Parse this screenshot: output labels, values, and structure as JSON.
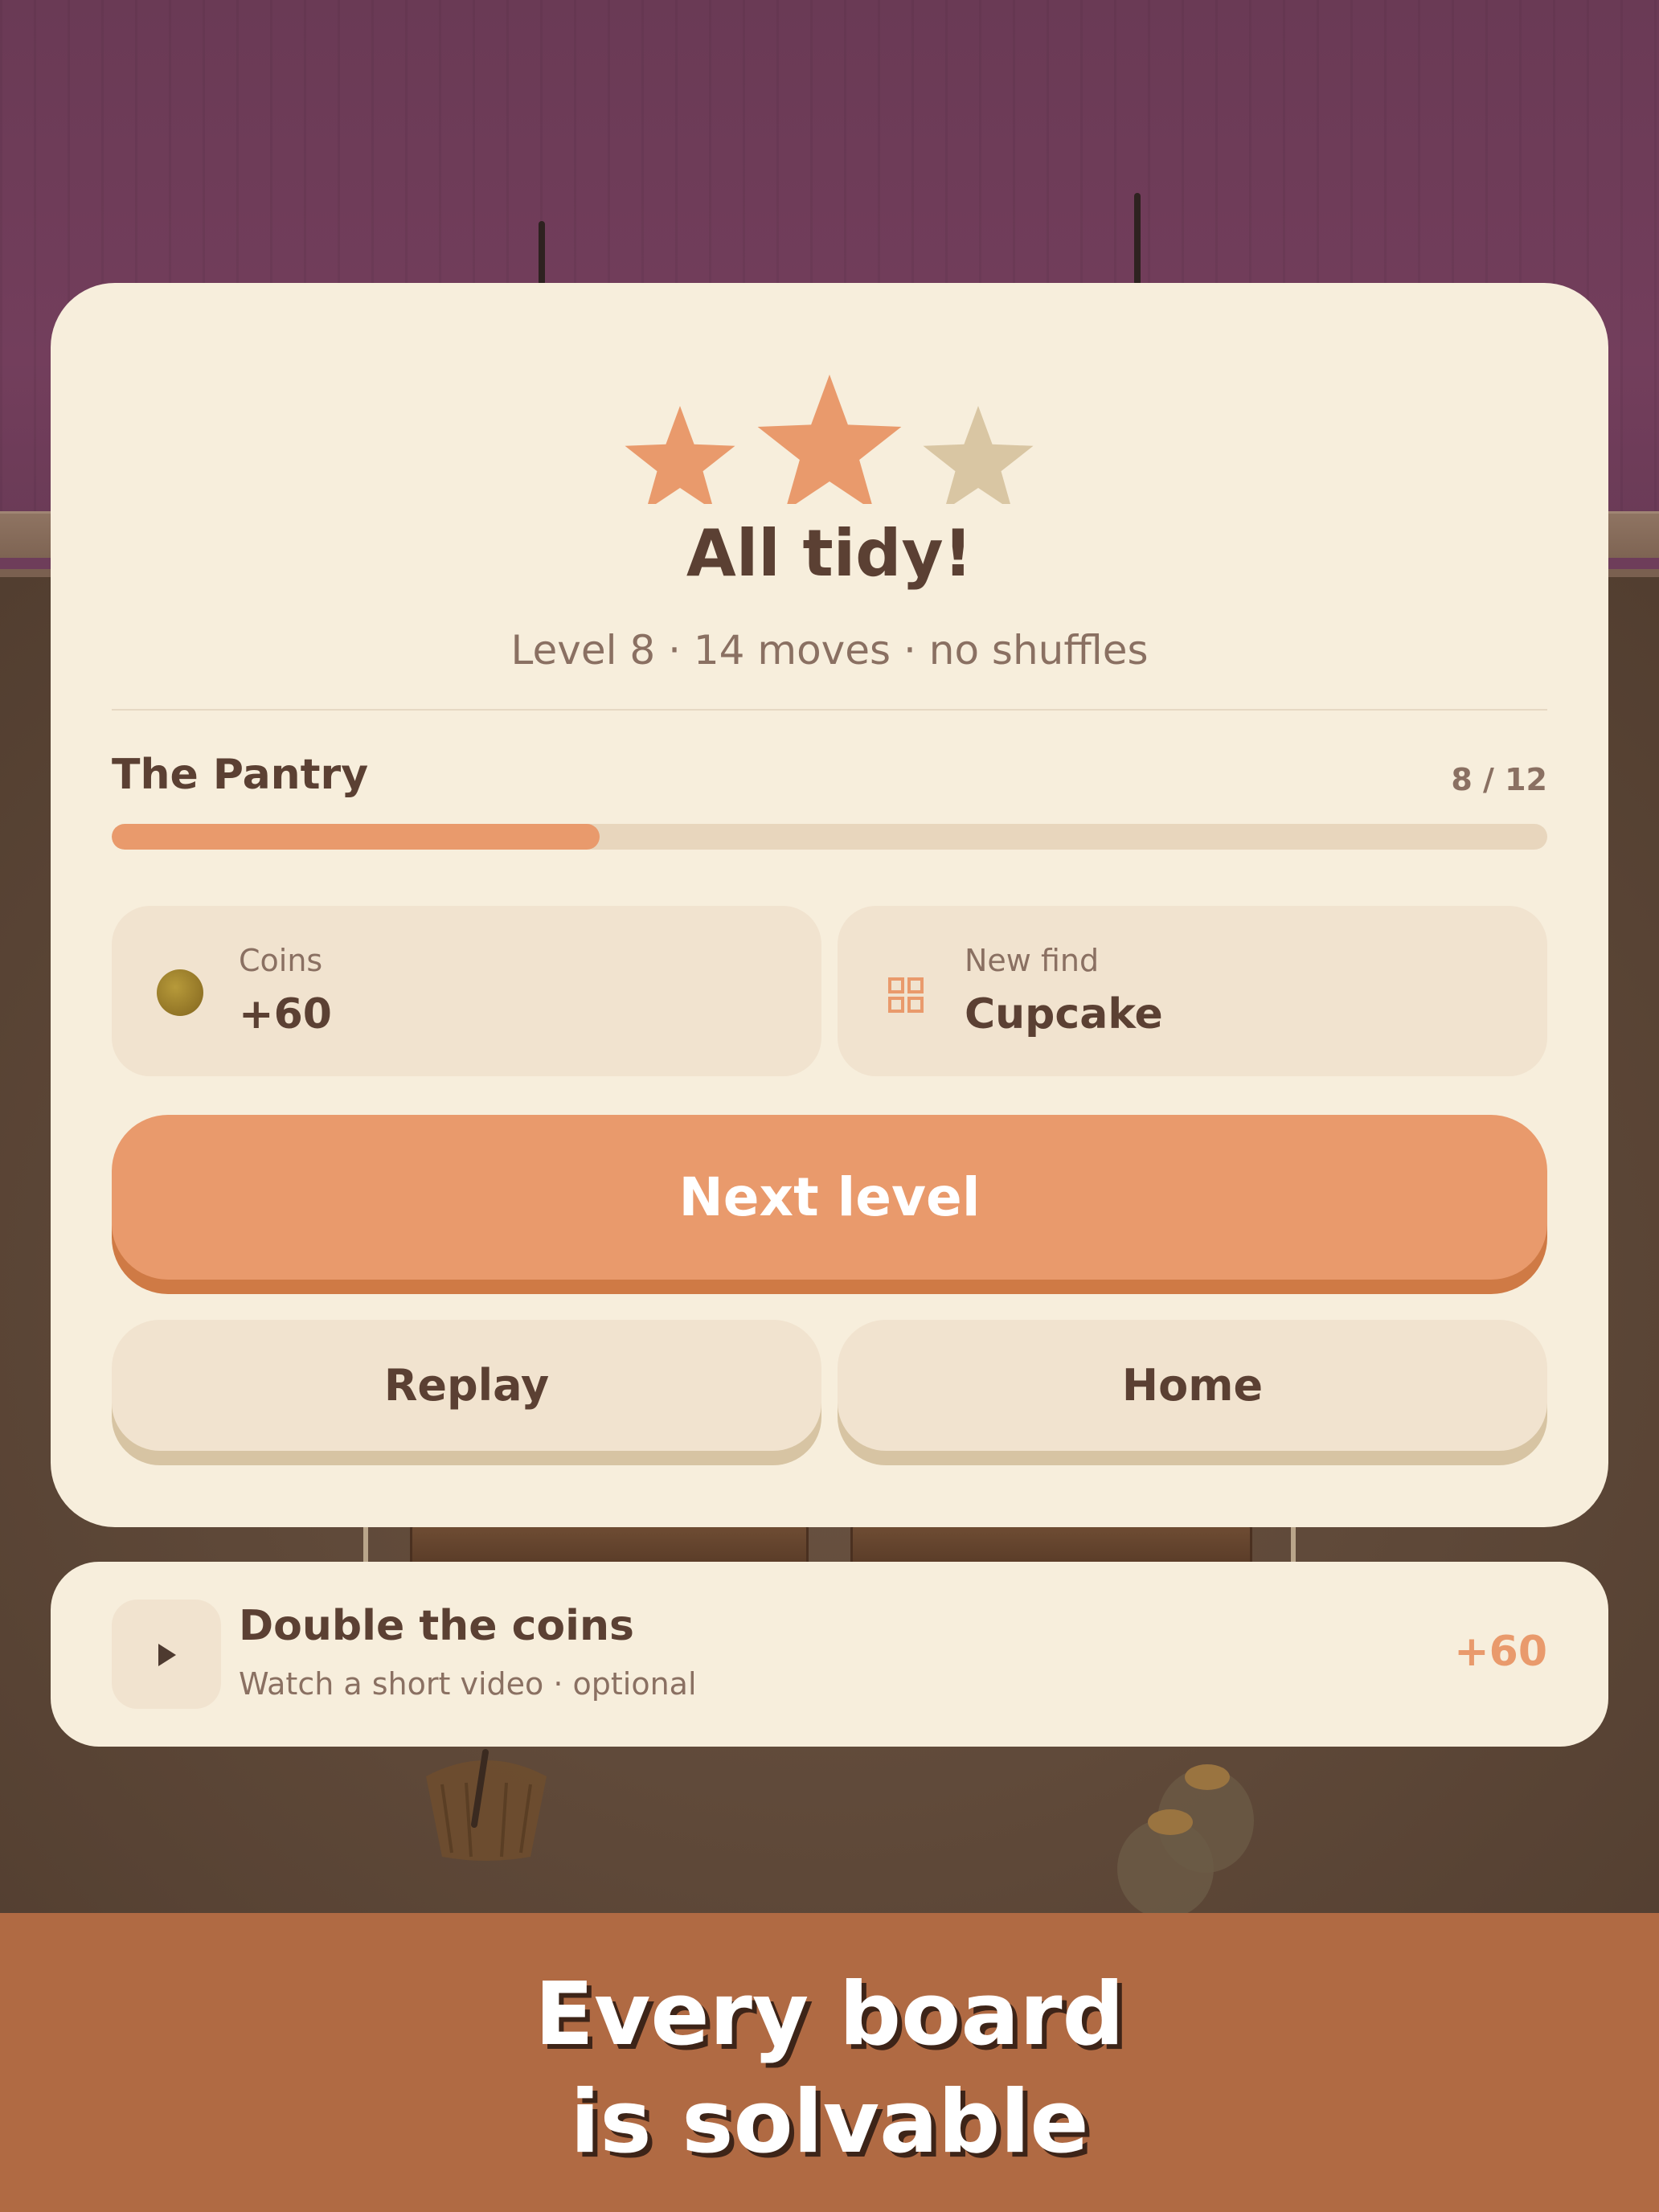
{
  "result": {
    "stars_earned": 2,
    "stars_total": 3,
    "title": "All tidy!",
    "subtitle": "Level 8 · 14 moves · no shuffles"
  },
  "area": {
    "name": "The Pantry",
    "count": "8 / 12",
    "progress_fraction": 0.34
  },
  "rewards": {
    "coins": {
      "label": "Coins",
      "value": "+60",
      "icon": "coin-icon"
    },
    "new_find": {
      "label": "New find",
      "value": "Cupcake",
      "icon": "grid-icon"
    }
  },
  "buttons": {
    "next": "Next level",
    "replay": "Replay",
    "home": "Home"
  },
  "bonus": {
    "title": "Double the coins",
    "subtitle": "Watch a short video · optional",
    "value": "+60",
    "icon": "play-icon"
  },
  "banner": {
    "line1": "Every board",
    "line2": "is solvable"
  },
  "colors": {
    "accent": "#e99a6c",
    "star_filled": "#e99a6c",
    "star_empty": "#d9c6a3",
    "card": "#f7eedc",
    "text": "#5b4033",
    "banner": "#b06a43"
  }
}
